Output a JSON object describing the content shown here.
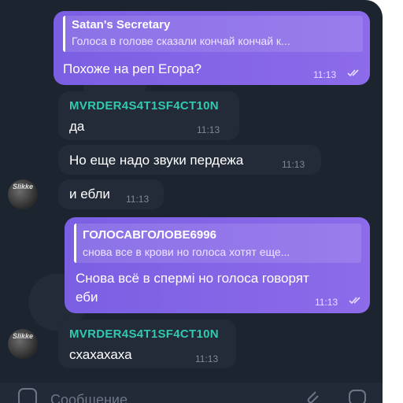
{
  "messages": [
    {
      "reply_name": "Satan's Secretary",
      "reply_text": "Голоса в голове сказали кончай кончай к...",
      "text": "Похоже на реп Егора?",
      "time": "11:13"
    },
    {
      "sender": "MVRDER4S4T1SF4CT10N",
      "text": "да",
      "time": "11:13"
    },
    {
      "text": "Но еще надо звуки пердежа",
      "time": "11:13"
    },
    {
      "text": "и ебли",
      "time": "11:13"
    },
    {
      "reply_name": "ГОЛОСАВГОЛОВЕ6996",
      "reply_text": "снова все в крови но голоса хотят еще...",
      "text_line1": "Снова всё в спермi но голоса говорят",
      "text_line2": "еби",
      "time": "11:13"
    },
    {
      "sender": "MVRDER4S4T1SF4CT10N",
      "text": "схахахаха",
      "time": "11:13"
    }
  ],
  "avatar_label": "Slikke",
  "input": {
    "placeholder": "Сообщение"
  },
  "colors": {
    "outgoing_bubble": "#8265e6",
    "incoming_bubble": "#232b38",
    "sender_name": "#32c9b0",
    "background": "#1c2430"
  }
}
